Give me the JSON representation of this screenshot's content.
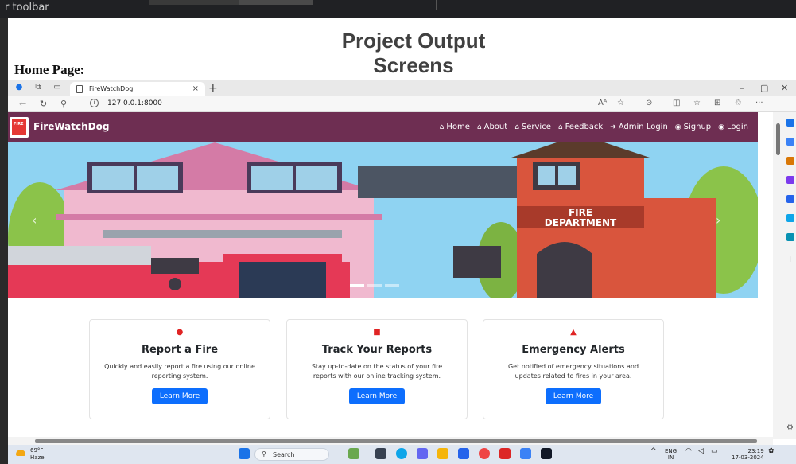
{
  "backdrop": {
    "toolbar_text": "r toolbar"
  },
  "document": {
    "title_line1": "Project Output",
    "title_line2": "Screens",
    "subtitle": "Home Page:"
  },
  "browser": {
    "tab_title": "FireWatchDog",
    "tab_close": "×",
    "new_tab": "+",
    "url": "127.0.0.1:8000",
    "reader_icon": "Aᴬ"
  },
  "site": {
    "brand": "FireWatchDog",
    "nav": [
      {
        "label": "Home",
        "icon": "home-icon"
      },
      {
        "label": "About",
        "icon": "home-icon"
      },
      {
        "label": "Service",
        "icon": "home-icon"
      },
      {
        "label": "Feedback",
        "icon": "home-icon"
      },
      {
        "label": "Admin Login",
        "icon": "sign-in-icon"
      },
      {
        "label": "Signup",
        "icon": "eye-icon"
      },
      {
        "label": "Login",
        "icon": "eye-icon"
      }
    ],
    "hero_sign": [
      "FIRE",
      "DEPARTMENT"
    ],
    "cards": [
      {
        "icon": "flame-icon",
        "title": "Report a Fire",
        "text": "Quickly and easily report a fire using our online reporting system.",
        "button": "Learn More"
      },
      {
        "icon": "clipboard-icon",
        "title": "Track Your Reports",
        "text": "Stay up-to-date on the status of your fire reports with our online tracking system.",
        "button": "Learn More"
      },
      {
        "icon": "warning-icon",
        "title": "Emergency Alerts",
        "text": "Get notified of emergency situations and updates related to fires in your area.",
        "button": "Learn More"
      }
    ]
  },
  "taskbar": {
    "temp": "69°F",
    "weather": "Haze",
    "search_placeholder": "Search",
    "lang": "ENG",
    "region": "IN",
    "time": "23:19",
    "date": "17-03-2024"
  },
  "colors": {
    "navbar": "#6e2e52",
    "button": "#0d6efd",
    "alert": "#e02424"
  }
}
